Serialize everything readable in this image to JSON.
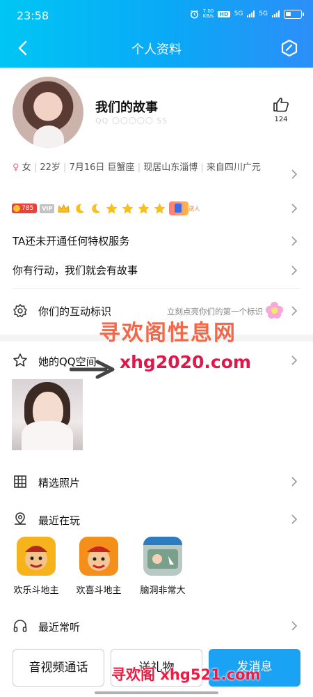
{
  "status_bar": {
    "time": "23:58",
    "net_speed_top": "7.00",
    "net_speed_bottom": "KB/s",
    "hd": "HD",
    "net1": "5G",
    "net2": "5G"
  },
  "header": {
    "title": "个人资料",
    "back_icon": "chevron-left-icon",
    "edit_icon": "hexagon-edit-icon",
    "background": "#00c6f4"
  },
  "profile": {
    "nickname": "我们的故事",
    "qq_number": "QQ 〇〇〇〇〇 55",
    "likes": "124"
  },
  "info": {
    "gender_symbol": "♀",
    "gender": "女",
    "age": "22岁",
    "birthday": "7月16日",
    "zodiac": "巨蟹座",
    "location": "现居山东淄博",
    "hometown": "来自四川广元",
    "separator": "|"
  },
  "badges": {
    "level": "785",
    "vip": "VIP",
    "gift_text": "送人"
  },
  "privilege": {
    "text": "TA还未开通任何特权服务"
  },
  "story": {
    "text": "你有行动，我们就会有故事"
  },
  "interaction": {
    "title": "你们的互动标识",
    "hint": "立刻点亮你们的第一个标识"
  },
  "qzone": {
    "title": "她的QQ空间"
  },
  "photos": {
    "title": "精选照片"
  },
  "recent_play": {
    "title": "最近在玩",
    "games": [
      {
        "name": "欢乐斗地主",
        "color": "#f7b31c"
      },
      {
        "name": "欢喜斗地主",
        "color": "#f58f1c"
      },
      {
        "name": "脑洞非常大",
        "color": "#b8c8c4"
      }
    ]
  },
  "recent_listen": {
    "title": "最近常听"
  },
  "actions": {
    "call": "音视频通话",
    "gift": "送礼物",
    "message": "发消息"
  },
  "watermarks": {
    "site_name": "寻欢阁性息网",
    "site_url": "xhg2020.com",
    "bottom": "寻欢阁 xhg521.com"
  },
  "colors": {
    "accent": "#1aa3f5",
    "female": "#ef5d9c",
    "watermark_red": "#e0174b"
  }
}
